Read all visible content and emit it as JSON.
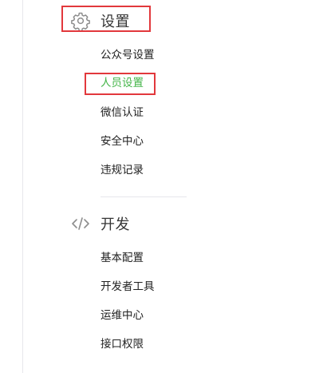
{
  "settings_section": {
    "title": "设置",
    "icon": "gear-icon",
    "items": [
      {
        "label": "公众号设置",
        "active": false
      },
      {
        "label": "人员设置",
        "active": true
      },
      {
        "label": "微信认证",
        "active": false
      },
      {
        "label": "安全中心",
        "active": false
      },
      {
        "label": "违规记录",
        "active": false
      }
    ]
  },
  "develop_section": {
    "title": "开发",
    "icon": "code-icon",
    "items": [
      {
        "label": "基本配置"
      },
      {
        "label": "开发者工具"
      },
      {
        "label": "运维中心"
      },
      {
        "label": "接口权限"
      }
    ]
  },
  "colors": {
    "active_text": "#44b549",
    "highlight_box": "#e2383c",
    "divider": "#e7e7eb"
  }
}
